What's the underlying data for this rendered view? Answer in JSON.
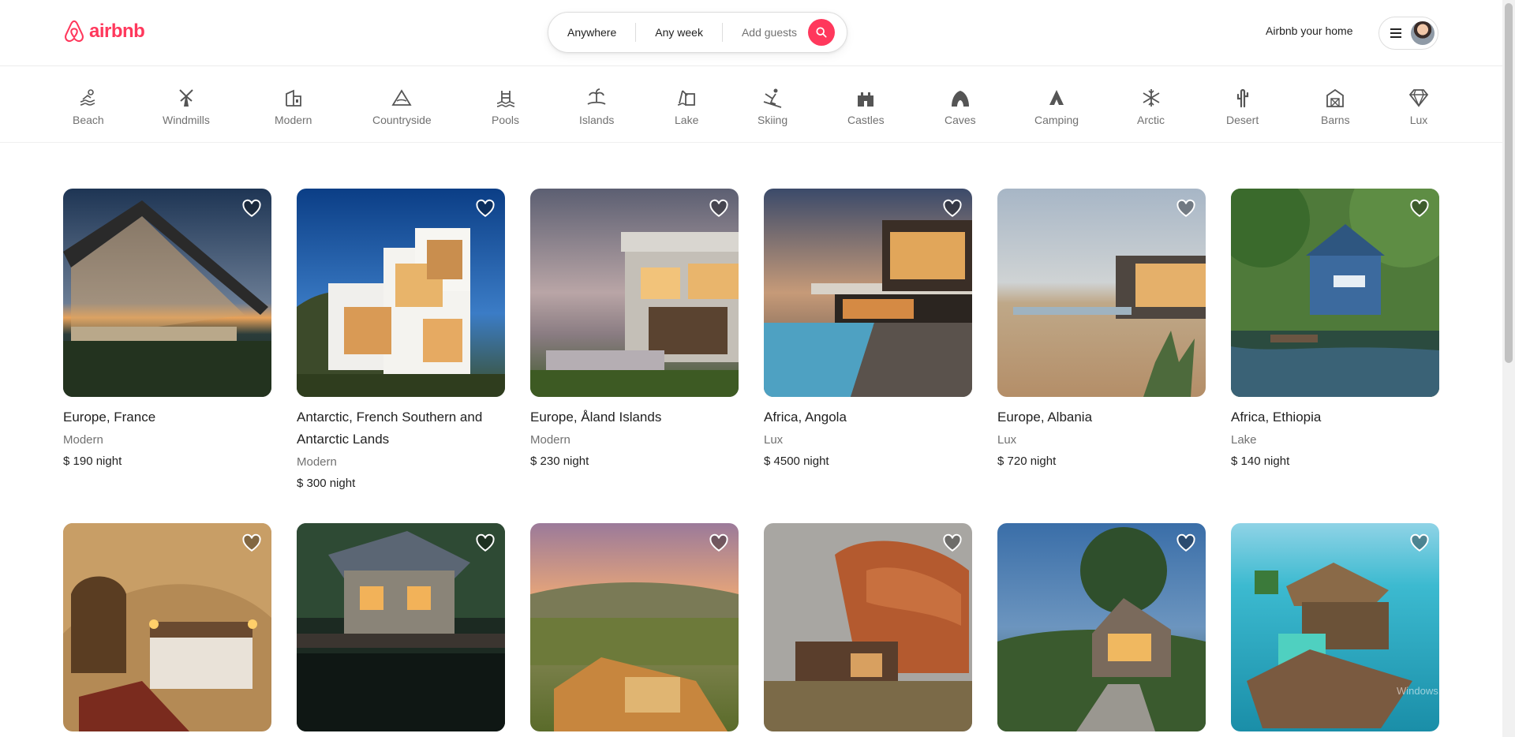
{
  "brand": {
    "name": "airbnb",
    "color": "#FF385C"
  },
  "search": {
    "anywhere": "Anywhere",
    "any_week": "Any week",
    "add_guests": "Add guests"
  },
  "header": {
    "host_link": "Airbnb your home"
  },
  "categories": [
    {
      "label": "Beach",
      "icon": "beach-icon"
    },
    {
      "label": "Windmills",
      "icon": "windmill-icon"
    },
    {
      "label": "Modern",
      "icon": "modern-house-icon"
    },
    {
      "label": "Countryside",
      "icon": "countryside-icon"
    },
    {
      "label": "Pools",
      "icon": "pool-icon"
    },
    {
      "label": "Islands",
      "icon": "island-icon"
    },
    {
      "label": "Lake",
      "icon": "lake-icon"
    },
    {
      "label": "Skiing",
      "icon": "skiing-icon"
    },
    {
      "label": "Castles",
      "icon": "castle-icon"
    },
    {
      "label": "Caves",
      "icon": "cave-icon"
    },
    {
      "label": "Camping",
      "icon": "camping-icon"
    },
    {
      "label": "Arctic",
      "icon": "snowflake-icon"
    },
    {
      "label": "Desert",
      "icon": "cactus-icon"
    },
    {
      "label": "Barns",
      "icon": "barn-icon"
    },
    {
      "label": "Lux",
      "icon": "diamond-icon"
    }
  ],
  "listings": [
    {
      "title": "Europe, France",
      "category": "Modern",
      "price": "$ 190",
      "unit": "night"
    },
    {
      "title": "Antarctic, French Southern and Antarctic Lands",
      "category": "Modern",
      "price": "$ 300",
      "unit": "night"
    },
    {
      "title": "Europe, Åland Islands",
      "category": "Modern",
      "price": "$ 230",
      "unit": "night"
    },
    {
      "title": "Africa, Angola",
      "category": "Lux",
      "price": "$ 4500",
      "unit": "night"
    },
    {
      "title": "Europe, Albania",
      "category": "Lux",
      "price": "$ 720",
      "unit": "night"
    },
    {
      "title": "Africa, Ethiopia",
      "category": "Lake",
      "price": "$ 140",
      "unit": "night"
    }
  ],
  "watermark": "Windows."
}
